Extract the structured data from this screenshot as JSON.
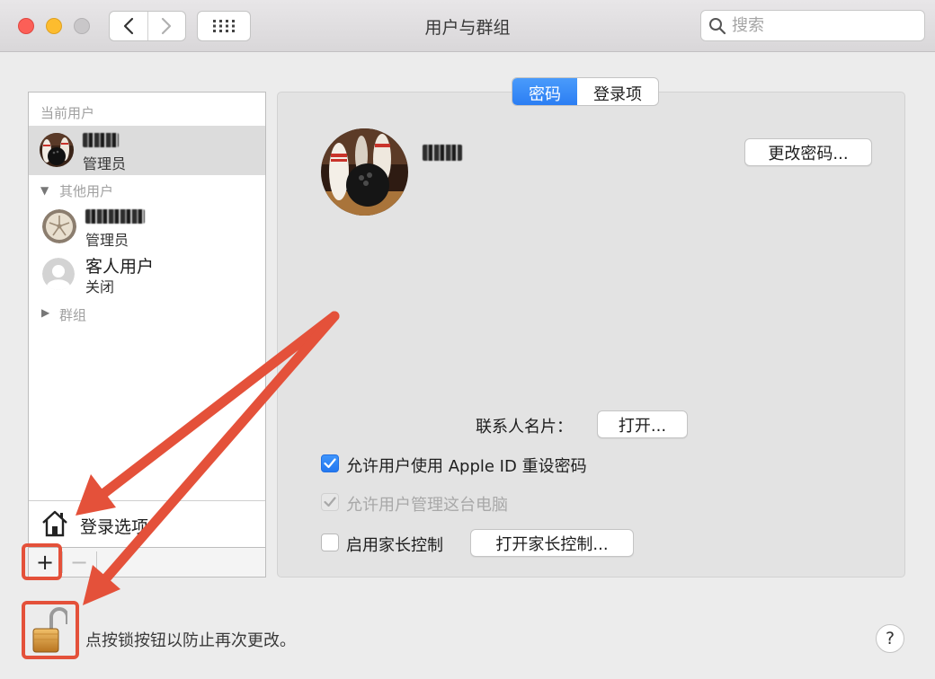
{
  "window": {
    "title": "用户与群组"
  },
  "search": {
    "placeholder": "搜索"
  },
  "sidebar": {
    "current_users_label": "当前用户",
    "current_user": {
      "role": "管理员"
    },
    "other_users_label": "其他用户",
    "other_users": [
      {
        "role": "管理员"
      },
      {
        "name": "客人用户",
        "status": "关闭"
      }
    ],
    "groups_label": "群组",
    "login_options_label": "登录选项",
    "add_label": "+",
    "remove_label": "−"
  },
  "tabs": [
    {
      "label": "密码",
      "active": true
    },
    {
      "label": "登录项",
      "active": false
    }
  ],
  "main": {
    "change_password_label": "更改密码...",
    "contact_card_label": "联系人名片：",
    "open_label": "打开...",
    "options": [
      {
        "label": "允许用户使用 Apple ID 重设密码",
        "checked": true,
        "enabled": true
      },
      {
        "label": "允许用户管理这台电脑",
        "checked": true,
        "enabled": false
      },
      {
        "label": "启用家长控制",
        "checked": false,
        "enabled": true
      }
    ],
    "parental_controls_button": "打开家长控制..."
  },
  "footer": {
    "lock_message": "点按锁按钮以防止再次更改。",
    "help_label": "?"
  },
  "colors": {
    "accent": "#2b7ef3",
    "annotation": "#e4513a"
  }
}
